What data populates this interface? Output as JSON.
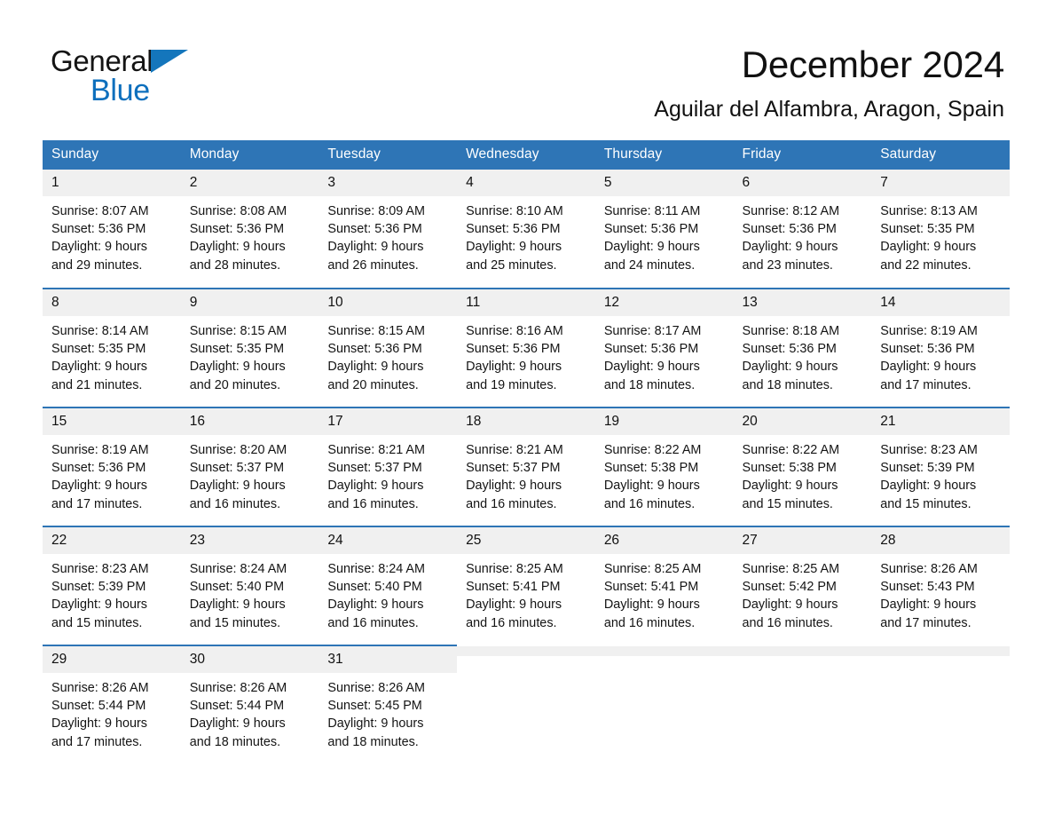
{
  "brand": {
    "name_part1": "General",
    "name_part2": "Blue",
    "triangle_color": "#1476bc",
    "blue_color": "#0d6fbd"
  },
  "header": {
    "month_title": "December 2024",
    "location": "Aguilar del Alfambra, Aragon, Spain",
    "accent_color": "#2e75b6",
    "daynum_band_color": "#f0f0f0"
  },
  "calendar": {
    "weekday_headers": [
      "Sunday",
      "Monday",
      "Tuesday",
      "Wednesday",
      "Thursday",
      "Friday",
      "Saturday"
    ],
    "weeks": [
      [
        {
          "day": "1",
          "sunrise": "Sunrise: 8:07 AM",
          "sunset": "Sunset: 5:36 PM",
          "daylight_line1": "Daylight: 9 hours",
          "daylight_line2": "and 29 minutes."
        },
        {
          "day": "2",
          "sunrise": "Sunrise: 8:08 AM",
          "sunset": "Sunset: 5:36 PM",
          "daylight_line1": "Daylight: 9 hours",
          "daylight_line2": "and 28 minutes."
        },
        {
          "day": "3",
          "sunrise": "Sunrise: 8:09 AM",
          "sunset": "Sunset: 5:36 PM",
          "daylight_line1": "Daylight: 9 hours",
          "daylight_line2": "and 26 minutes."
        },
        {
          "day": "4",
          "sunrise": "Sunrise: 8:10 AM",
          "sunset": "Sunset: 5:36 PM",
          "daylight_line1": "Daylight: 9 hours",
          "daylight_line2": "and 25 minutes."
        },
        {
          "day": "5",
          "sunrise": "Sunrise: 8:11 AM",
          "sunset": "Sunset: 5:36 PM",
          "daylight_line1": "Daylight: 9 hours",
          "daylight_line2": "and 24 minutes."
        },
        {
          "day": "6",
          "sunrise": "Sunrise: 8:12 AM",
          "sunset": "Sunset: 5:36 PM",
          "daylight_line1": "Daylight: 9 hours",
          "daylight_line2": "and 23 minutes."
        },
        {
          "day": "7",
          "sunrise": "Sunrise: 8:13 AM",
          "sunset": "Sunset: 5:35 PM",
          "daylight_line1": "Daylight: 9 hours",
          "daylight_line2": "and 22 minutes."
        }
      ],
      [
        {
          "day": "8",
          "sunrise": "Sunrise: 8:14 AM",
          "sunset": "Sunset: 5:35 PM",
          "daylight_line1": "Daylight: 9 hours",
          "daylight_line2": "and 21 minutes."
        },
        {
          "day": "9",
          "sunrise": "Sunrise: 8:15 AM",
          "sunset": "Sunset: 5:35 PM",
          "daylight_line1": "Daylight: 9 hours",
          "daylight_line2": "and 20 minutes."
        },
        {
          "day": "10",
          "sunrise": "Sunrise: 8:15 AM",
          "sunset": "Sunset: 5:36 PM",
          "daylight_line1": "Daylight: 9 hours",
          "daylight_line2": "and 20 minutes."
        },
        {
          "day": "11",
          "sunrise": "Sunrise: 8:16 AM",
          "sunset": "Sunset: 5:36 PM",
          "daylight_line1": "Daylight: 9 hours",
          "daylight_line2": "and 19 minutes."
        },
        {
          "day": "12",
          "sunrise": "Sunrise: 8:17 AM",
          "sunset": "Sunset: 5:36 PM",
          "daylight_line1": "Daylight: 9 hours",
          "daylight_line2": "and 18 minutes."
        },
        {
          "day": "13",
          "sunrise": "Sunrise: 8:18 AM",
          "sunset": "Sunset: 5:36 PM",
          "daylight_line1": "Daylight: 9 hours",
          "daylight_line2": "and 18 minutes."
        },
        {
          "day": "14",
          "sunrise": "Sunrise: 8:19 AM",
          "sunset": "Sunset: 5:36 PM",
          "daylight_line1": "Daylight: 9 hours",
          "daylight_line2": "and 17 minutes."
        }
      ],
      [
        {
          "day": "15",
          "sunrise": "Sunrise: 8:19 AM",
          "sunset": "Sunset: 5:36 PM",
          "daylight_line1": "Daylight: 9 hours",
          "daylight_line2": "and 17 minutes."
        },
        {
          "day": "16",
          "sunrise": "Sunrise: 8:20 AM",
          "sunset": "Sunset: 5:37 PM",
          "daylight_line1": "Daylight: 9 hours",
          "daylight_line2": "and 16 minutes."
        },
        {
          "day": "17",
          "sunrise": "Sunrise: 8:21 AM",
          "sunset": "Sunset: 5:37 PM",
          "daylight_line1": "Daylight: 9 hours",
          "daylight_line2": "and 16 minutes."
        },
        {
          "day": "18",
          "sunrise": "Sunrise: 8:21 AM",
          "sunset": "Sunset: 5:37 PM",
          "daylight_line1": "Daylight: 9 hours",
          "daylight_line2": "and 16 minutes."
        },
        {
          "day": "19",
          "sunrise": "Sunrise: 8:22 AM",
          "sunset": "Sunset: 5:38 PM",
          "daylight_line1": "Daylight: 9 hours",
          "daylight_line2": "and 16 minutes."
        },
        {
          "day": "20",
          "sunrise": "Sunrise: 8:22 AM",
          "sunset": "Sunset: 5:38 PM",
          "daylight_line1": "Daylight: 9 hours",
          "daylight_line2": "and 15 minutes."
        },
        {
          "day": "21",
          "sunrise": "Sunrise: 8:23 AM",
          "sunset": "Sunset: 5:39 PM",
          "daylight_line1": "Daylight: 9 hours",
          "daylight_line2": "and 15 minutes."
        }
      ],
      [
        {
          "day": "22",
          "sunrise": "Sunrise: 8:23 AM",
          "sunset": "Sunset: 5:39 PM",
          "daylight_line1": "Daylight: 9 hours",
          "daylight_line2": "and 15 minutes."
        },
        {
          "day": "23",
          "sunrise": "Sunrise: 8:24 AM",
          "sunset": "Sunset: 5:40 PM",
          "daylight_line1": "Daylight: 9 hours",
          "daylight_line2": "and 15 minutes."
        },
        {
          "day": "24",
          "sunrise": "Sunrise: 8:24 AM",
          "sunset": "Sunset: 5:40 PM",
          "daylight_line1": "Daylight: 9 hours",
          "daylight_line2": "and 16 minutes."
        },
        {
          "day": "25",
          "sunrise": "Sunrise: 8:25 AM",
          "sunset": "Sunset: 5:41 PM",
          "daylight_line1": "Daylight: 9 hours",
          "daylight_line2": "and 16 minutes."
        },
        {
          "day": "26",
          "sunrise": "Sunrise: 8:25 AM",
          "sunset": "Sunset: 5:41 PM",
          "daylight_line1": "Daylight: 9 hours",
          "daylight_line2": "and 16 minutes."
        },
        {
          "day": "27",
          "sunrise": "Sunrise: 8:25 AM",
          "sunset": "Sunset: 5:42 PM",
          "daylight_line1": "Daylight: 9 hours",
          "daylight_line2": "and 16 minutes."
        },
        {
          "day": "28",
          "sunrise": "Sunrise: 8:26 AM",
          "sunset": "Sunset: 5:43 PM",
          "daylight_line1": "Daylight: 9 hours",
          "daylight_line2": "and 17 minutes."
        }
      ],
      [
        {
          "day": "29",
          "sunrise": "Sunrise: 8:26 AM",
          "sunset": "Sunset: 5:44 PM",
          "daylight_line1": "Daylight: 9 hours",
          "daylight_line2": "and 17 minutes."
        },
        {
          "day": "30",
          "sunrise": "Sunrise: 8:26 AM",
          "sunset": "Sunset: 5:44 PM",
          "daylight_line1": "Daylight: 9 hours",
          "daylight_line2": "and 18 minutes."
        },
        {
          "day": "31",
          "sunrise": "Sunrise: 8:26 AM",
          "sunset": "Sunset: 5:45 PM",
          "daylight_line1": "Daylight: 9 hours",
          "daylight_line2": "and 18 minutes."
        },
        {
          "day": "",
          "sunrise": "",
          "sunset": "",
          "daylight_line1": "",
          "daylight_line2": ""
        },
        {
          "day": "",
          "sunrise": "",
          "sunset": "",
          "daylight_line1": "",
          "daylight_line2": ""
        },
        {
          "day": "",
          "sunrise": "",
          "sunset": "",
          "daylight_line1": "",
          "daylight_line2": ""
        },
        {
          "day": "",
          "sunrise": "",
          "sunset": "",
          "daylight_line1": "",
          "daylight_line2": ""
        }
      ]
    ]
  }
}
